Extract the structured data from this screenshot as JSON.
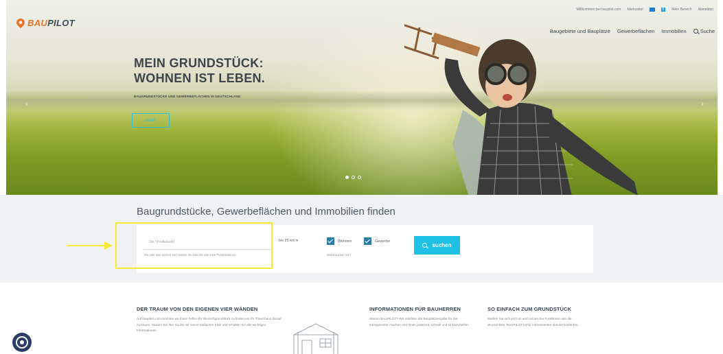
{
  "header": {
    "logo_text_accent": "BAU",
    "logo_text": "PILOT",
    "topbar": {
      "welcome": "Willkommen bei baupilot.com",
      "watchlist": "Merkzettel",
      "count_badge": "0",
      "my_area": "Mein Bereich",
      "logout": "Abmelden"
    },
    "nav": [
      {
        "label": "Baugebiete und Bauplätze"
      },
      {
        "label": "Gewerbeflächen"
      },
      {
        "label": "Immobilien"
      },
      {
        "label": "Suche"
      }
    ]
  },
  "hero": {
    "title": "MEIN GRUNDSTÜCK:\nWOHNEN IST LEBEN.",
    "subtitle": "BAUGRUNDSTÜCKE UND GEWERBEFLÄCHEN IN DEUTSCHLAND",
    "button_label": "MEHR",
    "arrow_left": "‹",
    "arrow_right": "›",
    "slides": 3,
    "active_slide": 1
  },
  "search": {
    "title": "Baugrundstücke, Gewerbeflächen und Immobilien finden",
    "location_placeholder": "Ort / Postleitzahl",
    "location_hint": "Wo oder was suchen Sie? Geben Sie bitte Ort oder eine Postleitzahl ein.",
    "radius": "bis 25 km ▾",
    "wohnen_label": "Wohnen",
    "gewerbe_label": "Gewerbe",
    "wohnen_checked": true,
    "gewerbe_checked": true,
    "extra_hint": "Wofür suchen Sie?",
    "button_label": "suchen"
  },
  "info": [
    {
      "title": "DER TRAUM VON DEN EIGENEN VIER WÄNDEN",
      "text": "Auf baupilot.com möchten wir Ihnen helfen Ihr Wunschgrundstück zu finden um Ihr Traumhaus darauf zu bauen. Starten Sie Ihre Suche mit einem einfachen Klick und erhalten Sie alle wichtigen Informationen."
    },
    {
      "title": "INFORMATIONEN FÜR BAUHERREN",
      "text": "Warum BAUPILOT? Wir möchten die Bauplatzvergabe für Sie transparenter machen und Ihnen jederzeit, schnell und einfach helfen."
    },
    {
      "title": "SO EINFACH ZUM GRUNDSTÜCK",
      "text": "Melden Sie sich jetzt an und nutzen Sie Funktionen wie die Wunschliste. BAUPILOT ist für Interessenten absolut kostenfrei."
    }
  ],
  "colors": {
    "accent": "#1ec0e4",
    "logo_orange": "#e8742a",
    "checkbox": "#2c7fa3",
    "annotation": "#f6e833"
  }
}
